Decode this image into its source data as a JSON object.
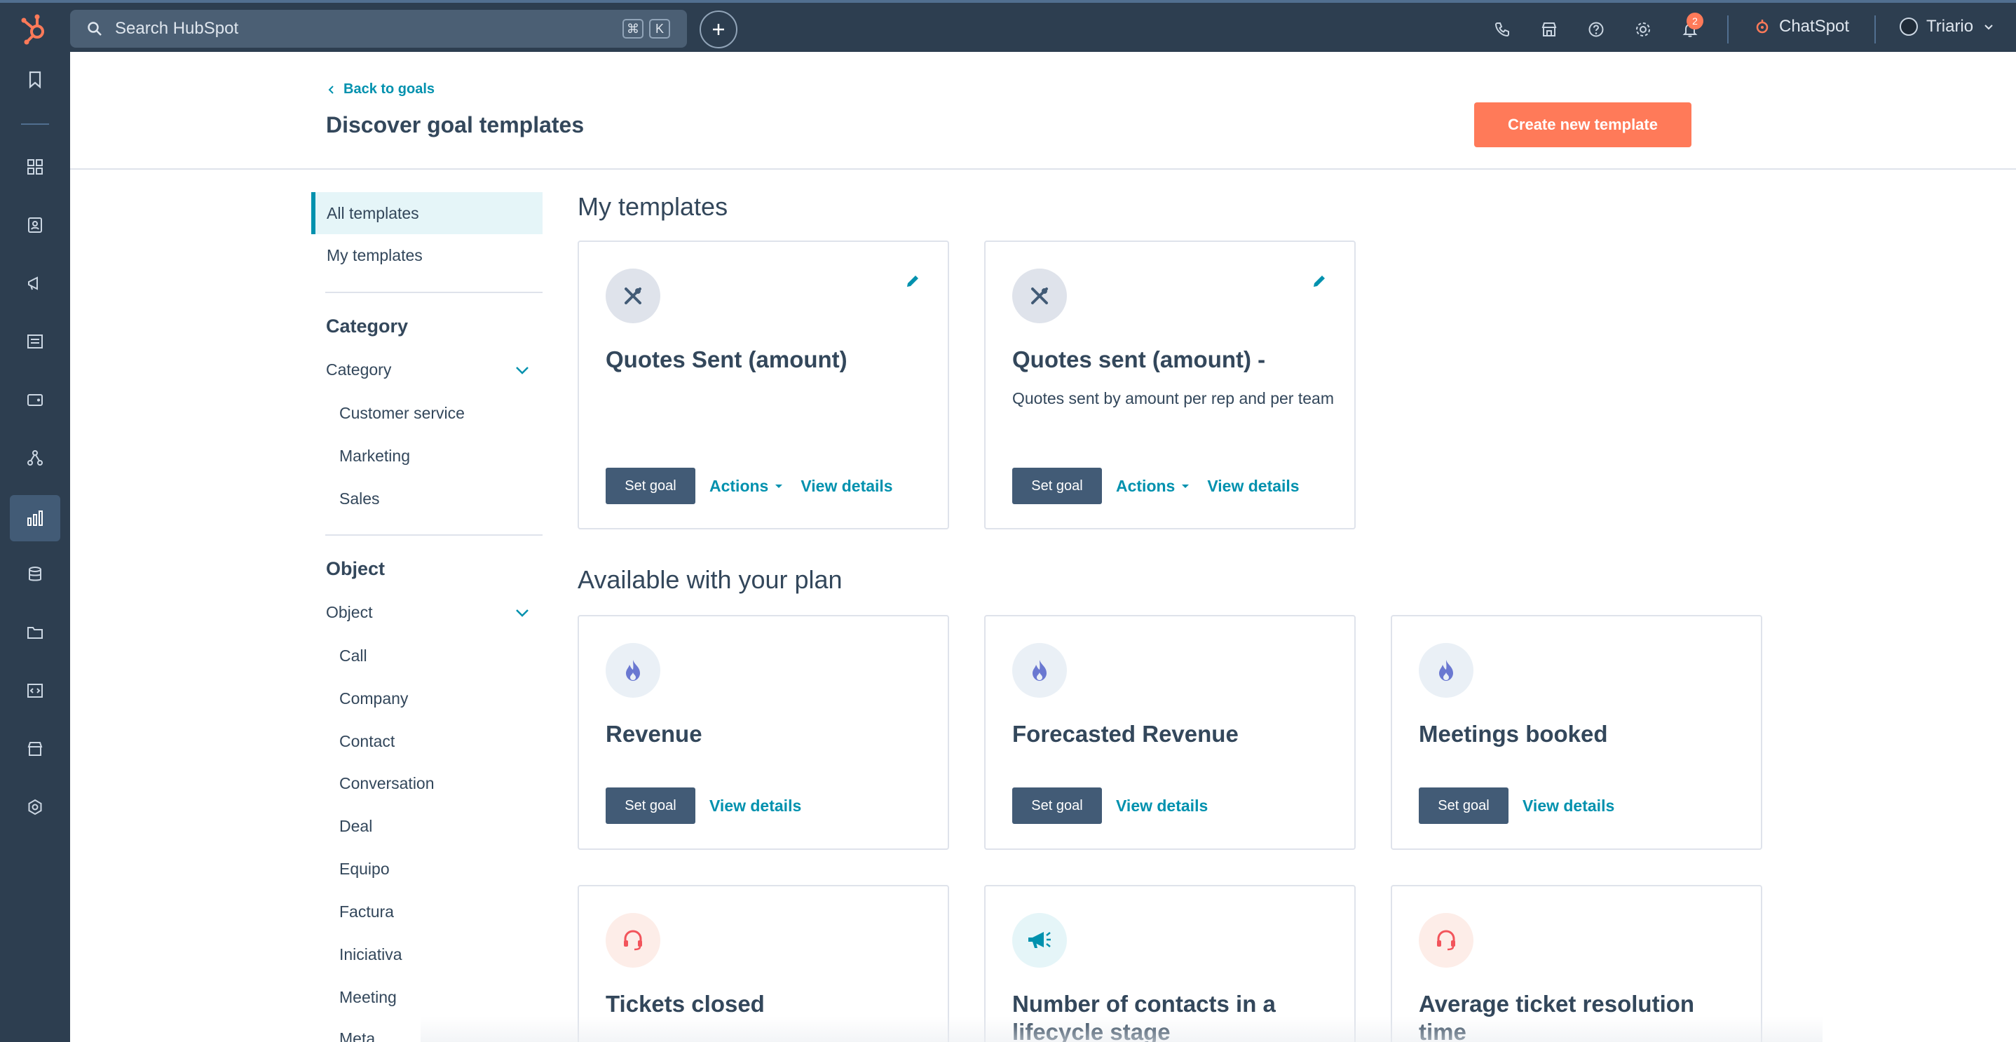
{
  "colors": {
    "topbar_bg": "#2d3e50",
    "brand_orange": "#ff7a59",
    "link_teal": "#0091ae",
    "primary_dark_button": "#425b76",
    "text_primary": "#33475b"
  },
  "topbar": {
    "search_placeholder": "Search HubSpot",
    "shortcut_cmd": "⌘",
    "shortcut_key": "K",
    "notification_count": "2",
    "chatspot_label": "ChatSpot",
    "account_name": "Triario",
    "icons": [
      "hubspot-logo",
      "search-icon",
      "plus-icon",
      "phone-icon",
      "marketplace-icon",
      "help-icon",
      "settings-icon",
      "bell-icon",
      "chatspot-icon",
      "avatar",
      "chevron-down-icon"
    ]
  },
  "leftnav": {
    "icons": [
      "bookmark-icon",
      "apps-icon",
      "contacts-icon",
      "marketing-icon",
      "content-icon",
      "commerce-icon",
      "automation-icon",
      "reporting-icon",
      "data-icon",
      "library-icon",
      "developer-icon",
      "marketplace-icon",
      "settings-icon"
    ],
    "active": "reporting-icon"
  },
  "header": {
    "back_link": "Back to goals",
    "title": "Discover goal templates",
    "create_button": "Create new template"
  },
  "filters": {
    "views": [
      {
        "label": "All templates",
        "active": true
      },
      {
        "label": "My templates",
        "active": false
      }
    ],
    "category": {
      "heading": "Category",
      "dropdown_label": "Category",
      "options": [
        "Customer service",
        "Marketing",
        "Sales"
      ]
    },
    "object": {
      "heading": "Object",
      "dropdown_label": "Object",
      "options": [
        "Call",
        "Company",
        "Contact",
        "Conversation",
        "Deal",
        "Equipo",
        "Factura",
        "Iniciativa",
        "Meeting",
        "Meta"
      ]
    }
  },
  "my_templates": {
    "heading": "My templates",
    "cards": [
      {
        "title": "Quotes Sent (amount)",
        "description": "",
        "icon": "tools-icon",
        "set_goal": "Set goal",
        "actions": "Actions",
        "view_details": "View details"
      },
      {
        "title": "Quotes sent (amount) -",
        "description": "Quotes sent by amount per rep and per team",
        "icon": "tools-icon",
        "set_goal": "Set goal",
        "actions": "Actions",
        "view_details": "View details"
      }
    ]
  },
  "available": {
    "heading": "Available with your plan",
    "cards": [
      {
        "title": "Revenue",
        "icon": "fire-icon",
        "set_goal": "Set goal",
        "view_details": "View details"
      },
      {
        "title": "Forecasted Revenue",
        "icon": "fire-icon",
        "set_goal": "Set goal",
        "view_details": "View details"
      },
      {
        "title": "Meetings booked",
        "icon": "fire-icon",
        "set_goal": "Set goal",
        "view_details": "View details"
      },
      {
        "title": "Tickets closed",
        "icon": "headset-icon"
      },
      {
        "title": "Number of contacts in a lifecycle stage",
        "icon": "megaphone-icon"
      },
      {
        "title": "Average ticket resolution time",
        "icon": "headset-icon"
      }
    ]
  }
}
